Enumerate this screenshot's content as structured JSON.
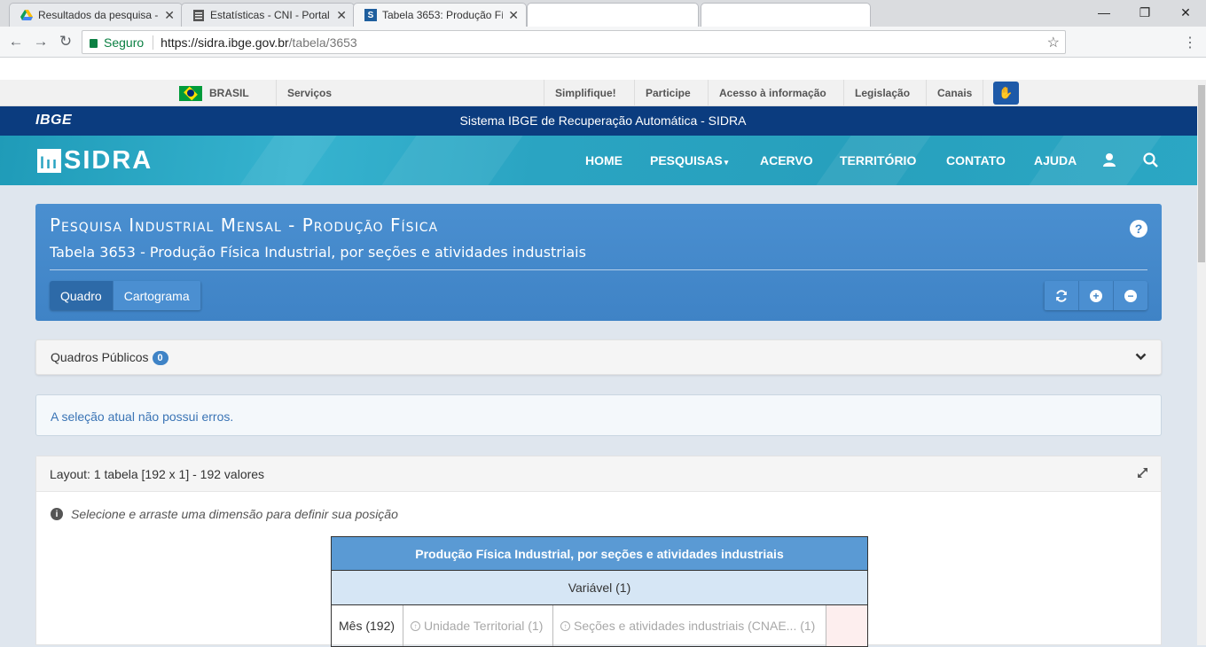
{
  "browser": {
    "tabs": [
      {
        "title": "Resultados da pesquisa - ",
        "icon": "google-drive-icon"
      },
      {
        "title": "Estatísticas - CNI - Portal",
        "icon": "document-icon"
      },
      {
        "title": "Tabela 3653: Produção Fí",
        "icon": "sidra-icon"
      },
      {
        "title": "",
        "icon": ""
      }
    ],
    "secure_label": "Seguro",
    "url_host": "https://sidra.ibge.gov.br",
    "url_path": "/tabela/3653"
  },
  "govbar": {
    "brasil": "BRASIL",
    "servicos": "Serviços",
    "links": [
      "Simplifique!",
      "Participe",
      "Acesso à informação",
      "Legislação",
      "Canais"
    ]
  },
  "ibge": {
    "logo": "IBGE",
    "system_title": "Sistema IBGE de Recuperação Automática - SIDRA"
  },
  "sidra": {
    "logo": "SIDRA",
    "nav": [
      "HOME",
      "PESQUISAS",
      "ACERVO",
      "TERRITÓRIO",
      "CONTATO",
      "AJUDA"
    ]
  },
  "panel": {
    "survey": "Pesquisa Industrial Mensal - Produção Física",
    "table_title": "Tabela 3653 - Produção Física Industrial, por seções e atividades industriais",
    "view_tabs": [
      "Quadro",
      "Cartograma"
    ]
  },
  "quadros": {
    "label": "Quadros Públicos",
    "count": "0"
  },
  "info": {
    "message": "A seleção atual não possui erros."
  },
  "layout": {
    "header": "Layout: 1 tabela [192 x 1] - 192 valores",
    "hint": "Selecione e arraste uma dimensão para definir sua posição",
    "grid_title": "Produção Física Industrial, por seções e atividades industriais",
    "variable": "Variável (1)",
    "dims": [
      "Mês (192)",
      "Unidade Territorial (1)",
      "Seções e atividades industriais (CNAE... (1)"
    ]
  },
  "colors": {
    "ibge_blue": "#0b3c7f",
    "sidra_teal": "#2aa4c2",
    "panel_blue": "#3f83c6"
  }
}
